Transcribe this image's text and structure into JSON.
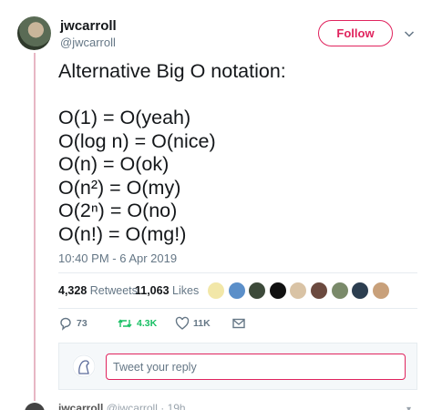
{
  "tweet": {
    "author_name": "jwcarroll",
    "author_handle": "@jwcarroll",
    "follow_label": "Follow",
    "text": "Alternative Big O notation:\n\nO(1) = O(yeah)\nO(log n) = O(nice)\nO(n) = O(ok)\nO(n²) = O(my)\nO(2ⁿ) = O(no)\nO(n!) = O(mg!)",
    "timestamp": "10:40 PM - 6 Apr 2019",
    "retweets_count": "4,328",
    "retweets_label": "Retweets",
    "likes_count": "11,063",
    "likes_label": "Likes",
    "likers": [
      {
        "icon": "liker-avatar",
        "color": "#f2e7a8"
      },
      {
        "icon": "liker-avatar",
        "color": "#5b8fc9"
      },
      {
        "icon": "liker-avatar",
        "color": "#3d4a3a"
      },
      {
        "icon": "liker-avatar",
        "color": "#111111"
      },
      {
        "icon": "liker-avatar",
        "color": "#d9c3a5"
      },
      {
        "icon": "liker-avatar",
        "color": "#6b4a3f"
      },
      {
        "icon": "liker-avatar",
        "color": "#7a8a6a"
      },
      {
        "icon": "liker-avatar",
        "color": "#2c3e50"
      },
      {
        "icon": "liker-avatar",
        "color": "#c8a07a"
      }
    ]
  },
  "actions": {
    "reply_count": "73",
    "retweet_count": "4.3K",
    "like_count": "11K",
    "reply_icon": "reply-icon",
    "retweet_icon": "retweet-icon",
    "like_icon": "heart-icon",
    "dm_icon": "envelope-icon"
  },
  "reply_box": {
    "placeholder": "Tweet your reply"
  },
  "next_tweet": {
    "author_name": "jwcarroll",
    "author_handle": "@jwcarroll",
    "time": "19h"
  },
  "colors": {
    "accent": "#e0245e",
    "retweet": "#17bf63",
    "muted": "#657786",
    "thread_line": "#e7b7c4"
  }
}
